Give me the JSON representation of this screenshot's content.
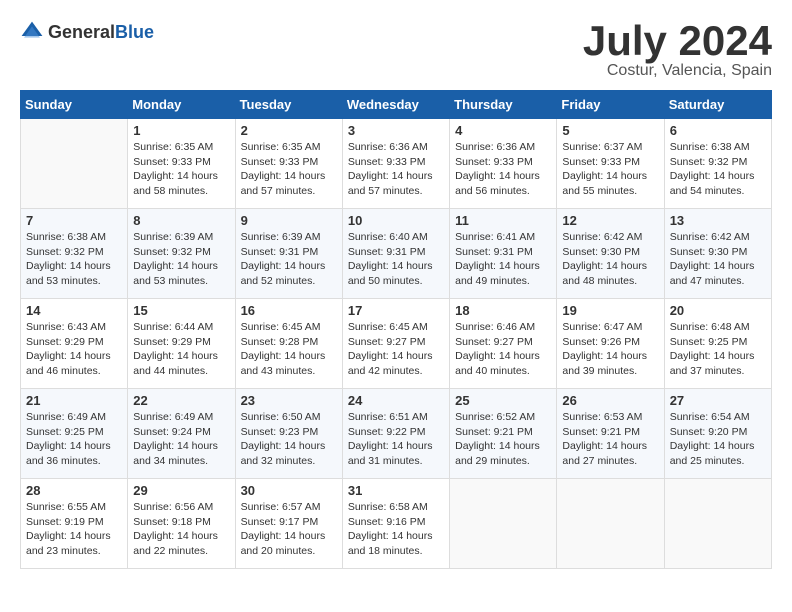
{
  "header": {
    "logo_general": "General",
    "logo_blue": "Blue",
    "month": "July 2024",
    "location": "Costur, Valencia, Spain"
  },
  "calendar": {
    "days_of_week": [
      "Sunday",
      "Monday",
      "Tuesday",
      "Wednesday",
      "Thursday",
      "Friday",
      "Saturday"
    ],
    "weeks": [
      [
        {
          "day": "",
          "info": ""
        },
        {
          "day": "1",
          "info": "Sunrise: 6:35 AM\nSunset: 9:33 PM\nDaylight: 14 hours\nand 58 minutes."
        },
        {
          "day": "2",
          "info": "Sunrise: 6:35 AM\nSunset: 9:33 PM\nDaylight: 14 hours\nand 57 minutes."
        },
        {
          "day": "3",
          "info": "Sunrise: 6:36 AM\nSunset: 9:33 PM\nDaylight: 14 hours\nand 57 minutes."
        },
        {
          "day": "4",
          "info": "Sunrise: 6:36 AM\nSunset: 9:33 PM\nDaylight: 14 hours\nand 56 minutes."
        },
        {
          "day": "5",
          "info": "Sunrise: 6:37 AM\nSunset: 9:33 PM\nDaylight: 14 hours\nand 55 minutes."
        },
        {
          "day": "6",
          "info": "Sunrise: 6:38 AM\nSunset: 9:32 PM\nDaylight: 14 hours\nand 54 minutes."
        }
      ],
      [
        {
          "day": "7",
          "info": "Sunrise: 6:38 AM\nSunset: 9:32 PM\nDaylight: 14 hours\nand 53 minutes."
        },
        {
          "day": "8",
          "info": "Sunrise: 6:39 AM\nSunset: 9:32 PM\nDaylight: 14 hours\nand 53 minutes."
        },
        {
          "day": "9",
          "info": "Sunrise: 6:39 AM\nSunset: 9:31 PM\nDaylight: 14 hours\nand 52 minutes."
        },
        {
          "day": "10",
          "info": "Sunrise: 6:40 AM\nSunset: 9:31 PM\nDaylight: 14 hours\nand 50 minutes."
        },
        {
          "day": "11",
          "info": "Sunrise: 6:41 AM\nSunset: 9:31 PM\nDaylight: 14 hours\nand 49 minutes."
        },
        {
          "day": "12",
          "info": "Sunrise: 6:42 AM\nSunset: 9:30 PM\nDaylight: 14 hours\nand 48 minutes."
        },
        {
          "day": "13",
          "info": "Sunrise: 6:42 AM\nSunset: 9:30 PM\nDaylight: 14 hours\nand 47 minutes."
        }
      ],
      [
        {
          "day": "14",
          "info": "Sunrise: 6:43 AM\nSunset: 9:29 PM\nDaylight: 14 hours\nand 46 minutes."
        },
        {
          "day": "15",
          "info": "Sunrise: 6:44 AM\nSunset: 9:29 PM\nDaylight: 14 hours\nand 44 minutes."
        },
        {
          "day": "16",
          "info": "Sunrise: 6:45 AM\nSunset: 9:28 PM\nDaylight: 14 hours\nand 43 minutes."
        },
        {
          "day": "17",
          "info": "Sunrise: 6:45 AM\nSunset: 9:27 PM\nDaylight: 14 hours\nand 42 minutes."
        },
        {
          "day": "18",
          "info": "Sunrise: 6:46 AM\nSunset: 9:27 PM\nDaylight: 14 hours\nand 40 minutes."
        },
        {
          "day": "19",
          "info": "Sunrise: 6:47 AM\nSunset: 9:26 PM\nDaylight: 14 hours\nand 39 minutes."
        },
        {
          "day": "20",
          "info": "Sunrise: 6:48 AM\nSunset: 9:25 PM\nDaylight: 14 hours\nand 37 minutes."
        }
      ],
      [
        {
          "day": "21",
          "info": "Sunrise: 6:49 AM\nSunset: 9:25 PM\nDaylight: 14 hours\nand 36 minutes."
        },
        {
          "day": "22",
          "info": "Sunrise: 6:49 AM\nSunset: 9:24 PM\nDaylight: 14 hours\nand 34 minutes."
        },
        {
          "day": "23",
          "info": "Sunrise: 6:50 AM\nSunset: 9:23 PM\nDaylight: 14 hours\nand 32 minutes."
        },
        {
          "day": "24",
          "info": "Sunrise: 6:51 AM\nSunset: 9:22 PM\nDaylight: 14 hours\nand 31 minutes."
        },
        {
          "day": "25",
          "info": "Sunrise: 6:52 AM\nSunset: 9:21 PM\nDaylight: 14 hours\nand 29 minutes."
        },
        {
          "day": "26",
          "info": "Sunrise: 6:53 AM\nSunset: 9:21 PM\nDaylight: 14 hours\nand 27 minutes."
        },
        {
          "day": "27",
          "info": "Sunrise: 6:54 AM\nSunset: 9:20 PM\nDaylight: 14 hours\nand 25 minutes."
        }
      ],
      [
        {
          "day": "28",
          "info": "Sunrise: 6:55 AM\nSunset: 9:19 PM\nDaylight: 14 hours\nand 23 minutes."
        },
        {
          "day": "29",
          "info": "Sunrise: 6:56 AM\nSunset: 9:18 PM\nDaylight: 14 hours\nand 22 minutes."
        },
        {
          "day": "30",
          "info": "Sunrise: 6:57 AM\nSunset: 9:17 PM\nDaylight: 14 hours\nand 20 minutes."
        },
        {
          "day": "31",
          "info": "Sunrise: 6:58 AM\nSunset: 9:16 PM\nDaylight: 14 hours\nand 18 minutes."
        },
        {
          "day": "",
          "info": ""
        },
        {
          "day": "",
          "info": ""
        },
        {
          "day": "",
          "info": ""
        }
      ]
    ]
  }
}
